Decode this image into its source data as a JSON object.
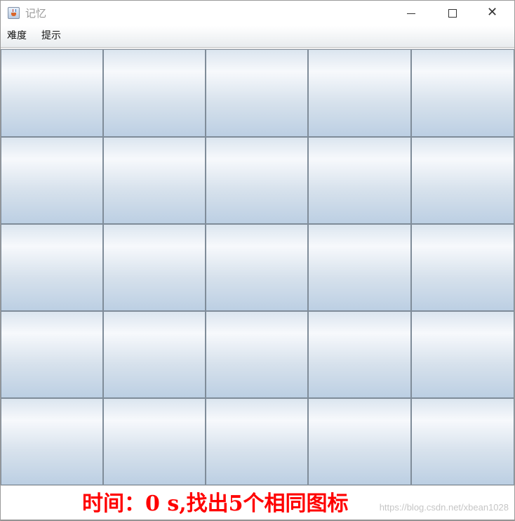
{
  "window": {
    "title": "记忆",
    "icon": "java-cup-icon",
    "controls": {
      "minimize": "minimize-icon",
      "maximize": "maximize-icon",
      "close": "close-icon"
    }
  },
  "menu": {
    "items": [
      {
        "label": "难度"
      },
      {
        "label": "提示"
      }
    ]
  },
  "board": {
    "rows": 5,
    "columns": 5,
    "cards": [
      {
        "state": "hidden"
      },
      {
        "state": "hidden"
      },
      {
        "state": "hidden"
      },
      {
        "state": "hidden"
      },
      {
        "state": "hidden"
      },
      {
        "state": "hidden"
      },
      {
        "state": "hidden"
      },
      {
        "state": "hidden"
      },
      {
        "state": "hidden"
      },
      {
        "state": "hidden"
      },
      {
        "state": "hidden"
      },
      {
        "state": "hidden"
      },
      {
        "state": "hidden"
      },
      {
        "state": "hidden"
      },
      {
        "state": "hidden"
      },
      {
        "state": "hidden"
      },
      {
        "state": "hidden"
      },
      {
        "state": "hidden"
      },
      {
        "state": "hidden"
      },
      {
        "state": "hidden"
      },
      {
        "state": "hidden"
      },
      {
        "state": "hidden"
      },
      {
        "state": "hidden"
      },
      {
        "state": "hidden"
      },
      {
        "state": "hidden"
      }
    ]
  },
  "status": {
    "text": "时间：0 s,找出5个相同图标",
    "color": "#ff0000"
  },
  "watermark": {
    "text": "https://blog.csdn.net/xbean1028"
  }
}
